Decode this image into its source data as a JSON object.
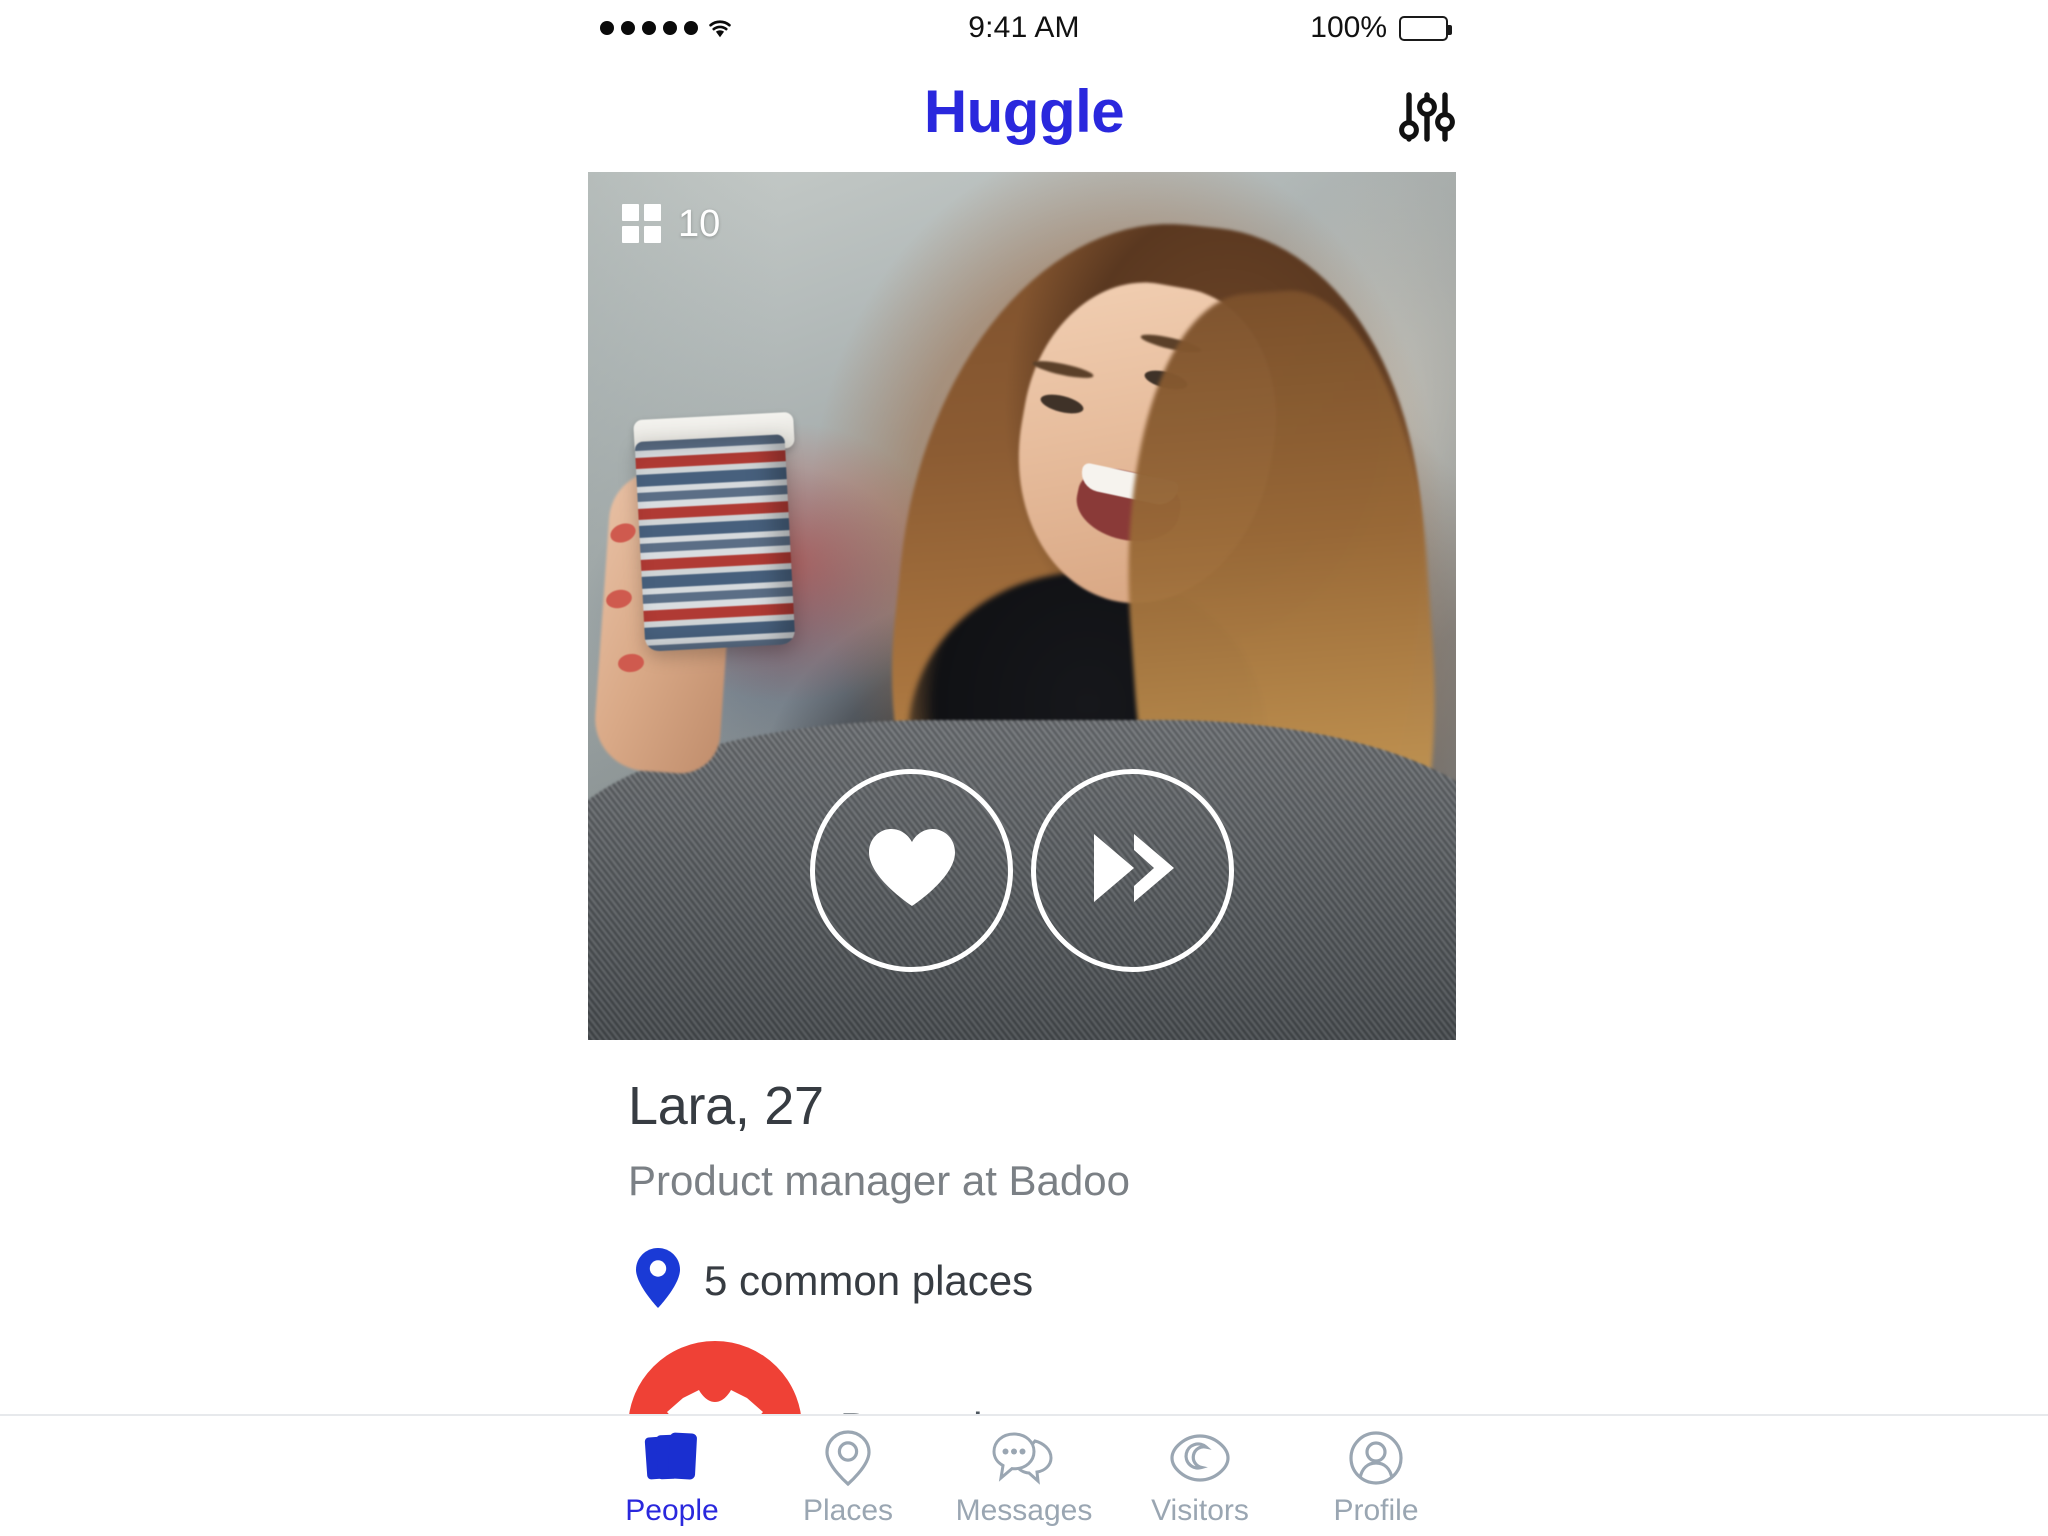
{
  "status_bar": {
    "signal_dots": 5,
    "signal_icon": "signal-dots-icon",
    "wifi_icon": "wifi-icon",
    "time": "9:41 AM",
    "battery_percent": "100%",
    "battery_icon": "battery-full-icon"
  },
  "header": {
    "brand": "Huggle",
    "brand_color": "#2a28dd",
    "filter_icon": "sliders-filter-icon"
  },
  "photo_card": {
    "counter_icon": "photo-grid-icon",
    "counter": "10",
    "like_icon": "heart-icon",
    "skip_icon": "double-chevron-right-icon"
  },
  "profile": {
    "name_age": "Lara, 27",
    "subtitle": "Product manager at Badoo",
    "common_places_icon": "map-pin-icon",
    "common_places": "5 common places",
    "places": [
      {
        "name": "Boxpark",
        "avatar_icon": "tshirt-icon",
        "avatar_color": "#ef4136"
      }
    ]
  },
  "tab_bar": {
    "active": "People",
    "items": [
      {
        "label": "People",
        "icon": "stacked-cards-icon",
        "active": true
      },
      {
        "label": "Places",
        "icon": "map-pin-outline-icon",
        "active": false
      },
      {
        "label": "Messages",
        "icon": "chat-bubbles-icon",
        "active": false
      },
      {
        "label": "Visitors",
        "icon": "eye-moon-icon",
        "active": false
      },
      {
        "label": "Profile",
        "icon": "person-circle-icon",
        "active": false
      }
    ]
  }
}
